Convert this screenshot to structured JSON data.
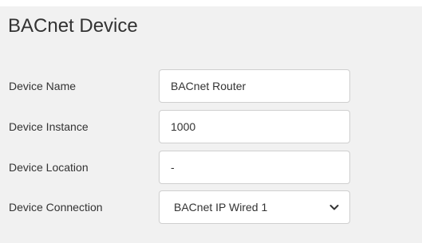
{
  "panel": {
    "title": "BACnet Device"
  },
  "fields": {
    "device_name": {
      "label": "Device Name",
      "value": "BACnet Router"
    },
    "device_instance": {
      "label": "Device Instance",
      "value": "1000"
    },
    "device_location": {
      "label": "Device Location",
      "value": "-"
    },
    "device_connection": {
      "label": "Device Connection",
      "selected": "BACnet IP Wired 1",
      "icon": "chevron-down-icon"
    }
  }
}
